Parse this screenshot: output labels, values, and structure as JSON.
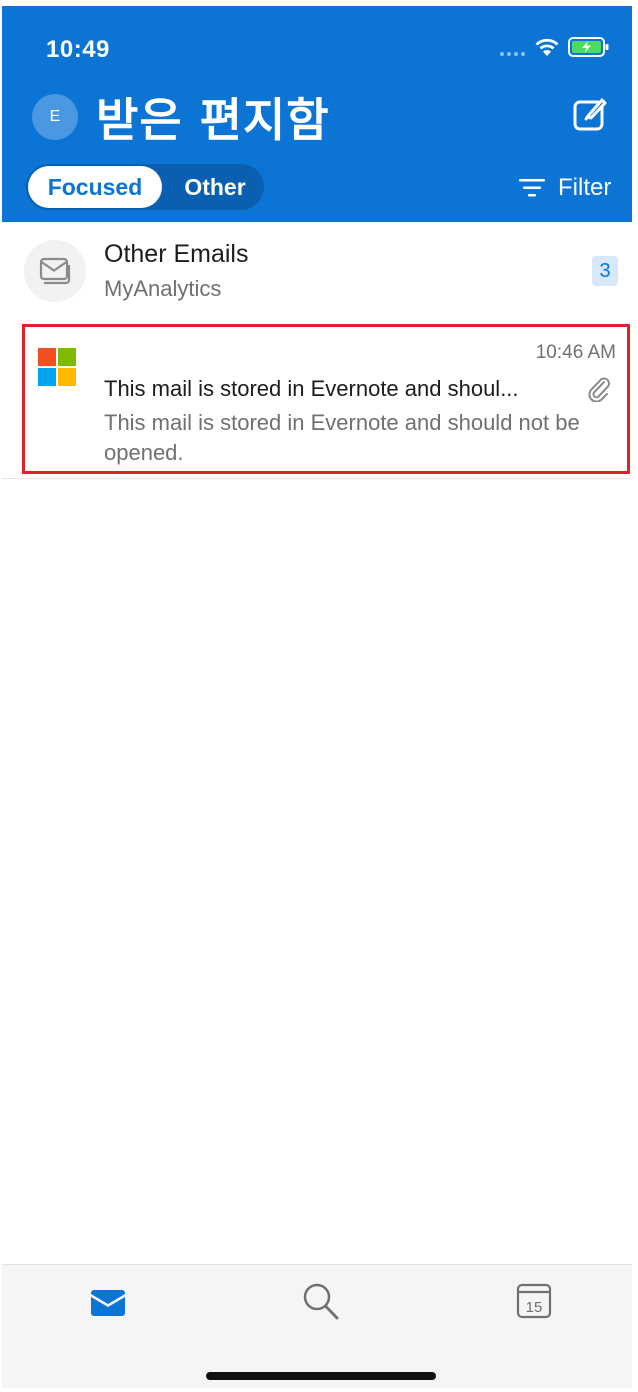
{
  "status_bar": {
    "time": "10:49",
    "icons": [
      "signal-dots-icon",
      "wifi-icon",
      "battery-charging-icon"
    ]
  },
  "header": {
    "avatar_initial": "E",
    "title": "받은 편지함",
    "compose_icon": "compose-icon",
    "tabs": [
      {
        "label": "Focused",
        "selected": true
      },
      {
        "label": "Other",
        "selected": false
      }
    ],
    "filter_label": "Filter"
  },
  "group": {
    "title": "Other Emails",
    "subtitle": "MyAnalytics",
    "count": "3"
  },
  "mail": {
    "time": "10:46 AM",
    "subject": "This mail is stored in Evernote and shoul...",
    "preview": "This mail is stored in Evernote and should not be opened.",
    "has_attachment": true,
    "sender_logo": "microsoft-logo"
  },
  "tabbar": {
    "items": [
      "mail-icon",
      "search-icon",
      "calendar-icon"
    ],
    "calendar_day": "15"
  },
  "colors": {
    "accent": "#0b74d4",
    "highlight": "#e0202a"
  }
}
